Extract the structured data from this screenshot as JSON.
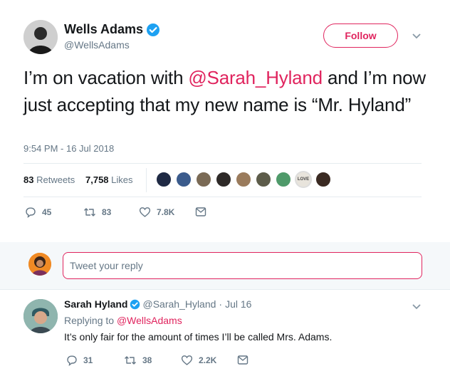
{
  "tweet": {
    "author_name": "Wells Adams",
    "author_handle": "@WellsAdams",
    "follow_label": "Follow",
    "text_before": "I’m on vacation with ",
    "mention": "@Sarah_Hyland",
    "text_after": " and I’m now just accepting that my new name is “Mr. Hyland”",
    "timestamp": "9:54 PM - 16 Jul 2018",
    "retweets_count": "83",
    "retweets_label": "Retweets",
    "likes_count": "7,758",
    "likes_label": "Likes",
    "actions": {
      "replies": "45",
      "retweets": "83",
      "likes": "7.8K"
    }
  },
  "likers": [
    {
      "name": "liker-1",
      "color": "#1f2a44"
    },
    {
      "name": "liker-2",
      "color": "#3b5b8c"
    },
    {
      "name": "liker-3",
      "color": "#7a6a55"
    },
    {
      "name": "liker-4",
      "color": "#2e2a28"
    },
    {
      "name": "liker-5",
      "color": "#9a7b5c"
    },
    {
      "name": "liker-6",
      "color": "#5d5c4a"
    },
    {
      "name": "liker-7",
      "color": "#4f9a6a"
    },
    {
      "name": "liker-8",
      "color": "#e8e4dc",
      "text": "LOVE"
    },
    {
      "name": "liker-9",
      "color": "#3a2a22"
    }
  ],
  "reply_box": {
    "placeholder": "Tweet your reply"
  },
  "reply": {
    "author_name": "Sarah Hyland",
    "author_handle": "@Sarah_Hyland",
    "separator": "·",
    "date": "Jul 16",
    "replying_to_label": "Replying to",
    "replying_to_handle": "@WellsAdams",
    "text": "It’s only fair for the amount of times I’ll be called Mrs. Adams.",
    "actions": {
      "replies": "31",
      "retweets": "38",
      "likes": "2.2K"
    }
  },
  "colors": {
    "accent": "#e0245e",
    "verified": "#1da1f2",
    "muted": "#657786",
    "divider": "#e6ecf0"
  }
}
